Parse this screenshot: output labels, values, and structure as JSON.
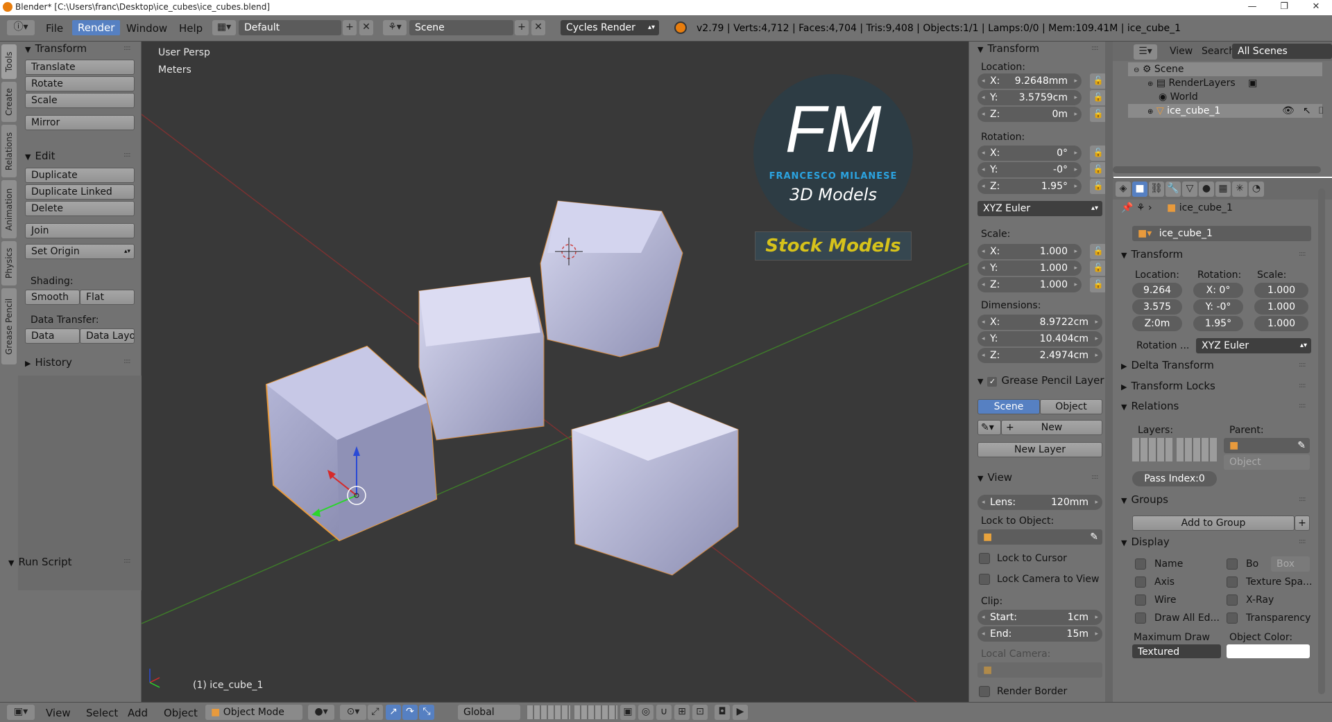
{
  "window": {
    "title": "Blender* [C:\\Users\\franc\\Desktop\\ice_cubes\\ice_cubes.blend]",
    "controls": [
      "—",
      "❐",
      "✕"
    ]
  },
  "topbar": {
    "menus": [
      "File",
      "Render",
      "Window",
      "Help"
    ],
    "active_menu": "Render",
    "layout": "Default",
    "scene": "Scene",
    "engine": "Cycles Render",
    "stats": "v2.79 | Verts:4,712 | Faces:4,704 | Tris:9,408 | Objects:1/1 | Lamps:0/0 | Mem:109.41M | ice_cube_1"
  },
  "left_tabs": [
    "Tools",
    "Create",
    "Relations",
    "Animation",
    "Physics",
    "Grease Pencil"
  ],
  "toolshelf": {
    "transform": {
      "title": "Transform",
      "buttons": [
        "Translate",
        "Rotate",
        "Scale",
        "Mirror"
      ]
    },
    "edit": {
      "title": "Edit",
      "buttons": [
        "Duplicate",
        "Duplicate Linked",
        "Delete",
        "Join"
      ],
      "set_origin": "Set Origin"
    },
    "shading": {
      "label": "Shading:",
      "smooth": "Smooth",
      "flat": "Flat"
    },
    "data_transfer": {
      "label": "Data Transfer:",
      "data": "Data",
      "data_layo": "Data Layo"
    },
    "history": "History",
    "run_script": "Run Script"
  },
  "viewport": {
    "view_name": "User Persp",
    "units": "Meters",
    "object_label": "(1) ice_cube_1",
    "watermark": {
      "letters": "FM",
      "name": "FRANCESCO MILANESE",
      "tag": "3D Models",
      "stock": "Stock Models"
    }
  },
  "npanel": {
    "transform_title": "Transform",
    "location_label": "Location:",
    "location": [
      {
        "k": "X:",
        "v": "9.2648mm"
      },
      {
        "k": "Y:",
        "v": "3.5759cm"
      },
      {
        "k": "Z:",
        "v": "0m"
      }
    ],
    "rotation_label": "Rotation:",
    "rotation": [
      {
        "k": "X:",
        "v": "0°"
      },
      {
        "k": "Y:",
        "v": "-0°"
      },
      {
        "k": "Z:",
        "v": "1.95°"
      }
    ],
    "rotation_mode": "XYZ Euler",
    "scale_label": "Scale:",
    "scale": [
      {
        "k": "X:",
        "v": "1.000"
      },
      {
        "k": "Y:",
        "v": "1.000"
      },
      {
        "k": "Z:",
        "v": "1.000"
      }
    ],
    "dimensions_label": "Dimensions:",
    "dimensions": [
      {
        "k": "X:",
        "v": "8.9722cm"
      },
      {
        "k": "Y:",
        "v": "10.404cm"
      },
      {
        "k": "Z:",
        "v": "2.4974cm"
      }
    ],
    "grease_title": "Grease Pencil Layer",
    "grease_scene": "Scene",
    "grease_object": "Object",
    "grease_new": "New",
    "grease_new_layer": "New Layer",
    "view_title": "View",
    "lens_key": "Lens:",
    "lens_val": "120mm",
    "lock_to_object": "Lock to Object:",
    "lock_to_cursor": "Lock to Cursor",
    "lock_camera": "Lock Camera to View",
    "clip_label": "Clip:",
    "clip_start_key": "Start:",
    "clip_start_val": "1cm",
    "clip_end_key": "End:",
    "clip_end_val": "15m",
    "local_camera": "Local Camera:",
    "render_border": "Render Border"
  },
  "outliner": {
    "menus": [
      "View",
      "Search"
    ],
    "filter": "All Scenes",
    "items": [
      "Scene",
      "RenderLayers",
      "World",
      "ice_cube_1"
    ]
  },
  "properties": {
    "breadcrumb": "ice_cube_1",
    "object_name": "ice_cube_1",
    "transform_title": "Transform",
    "loc_label": "Location:",
    "rot_label": "Rotation:",
    "scale_label": "Scale:",
    "loc": [
      "9.264",
      "3.575",
      "Z:0m"
    ],
    "rot": [
      "X:  0°",
      "Y: -0°",
      "1.95°"
    ],
    "scl": [
      "1.000",
      "1.000",
      "1.000"
    ],
    "rotation_mode_label": "Rotation ...",
    "rotation_mode": "XYZ Euler",
    "delta_transform": "Delta Transform",
    "transform_locks": "Transform Locks",
    "relations": "Relations",
    "layers_label": "Layers:",
    "parent_label": "Parent:",
    "parent_type": "Object",
    "pass_index": "Pass Index:0",
    "groups": "Groups",
    "add_to_group": "Add to Group",
    "display": "Display",
    "disp_name": "Name",
    "disp_bo": "Bo",
    "disp_box": "Box",
    "disp_axis": "Axis",
    "disp_texture": "Texture Spa...",
    "disp_wire": "Wire",
    "disp_xray": "X-Ray",
    "disp_drawall": "Draw All Ed...",
    "disp_transparency": "Transparency",
    "max_draw": "Maximum Draw",
    "object_color": "Object Color:",
    "textured": "Textured"
  },
  "bottombar": {
    "menus": [
      "View",
      "Select",
      "Add",
      "Object"
    ],
    "mode": "Object Mode",
    "orientation": "Global"
  },
  "colors": {
    "panel": "#727272",
    "viewport": "#393939",
    "accent": "#5680c2",
    "selection": "#e89a3c",
    "watermark_blue": "#2ba3e0",
    "watermark_yellow": "#d6c21b"
  }
}
